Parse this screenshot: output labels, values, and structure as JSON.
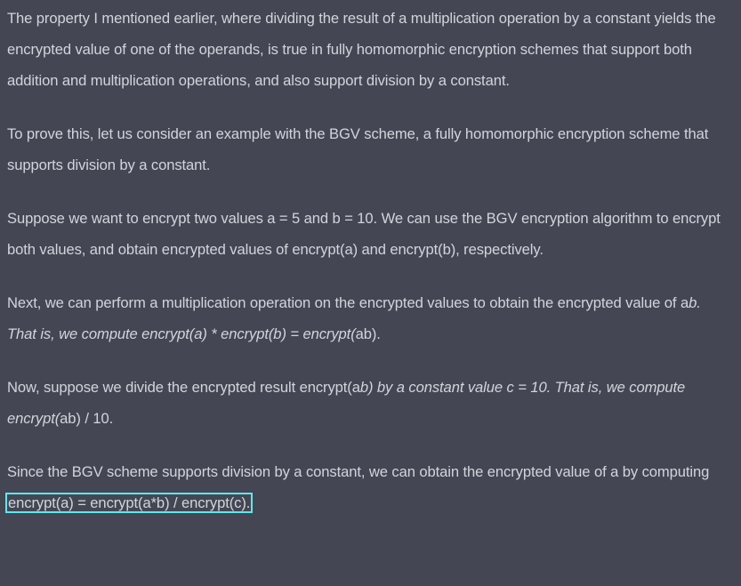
{
  "message": {
    "paragraphs": [
      {
        "segments": [
          {
            "text": "The property I mentioned earlier, where dividing the result of a multiplication operation by a constant yields the encrypted value of one of the operands, is true in fully homomorphic encryption schemes that support both addition and multiplication operations, and also support division by a constant.",
            "style": "normal"
          }
        ]
      },
      {
        "segments": [
          {
            "text": "To prove this, let us consider an example with the BGV scheme, a fully homomorphic encryption scheme that supports division by a constant.",
            "style": "normal"
          }
        ]
      },
      {
        "segments": [
          {
            "text": "Suppose we want to encrypt two values a = 5 and b = 10. We can use the BGV encryption algorithm to encrypt both values, and obtain encrypted values of encrypt(a) and encrypt(b), respectively.",
            "style": "normal"
          }
        ]
      },
      {
        "segments": [
          {
            "text": "Next, we can perform a multiplication operation on the encrypted values to obtain the encrypted value of a",
            "style": "normal"
          },
          {
            "text": "b. That is, we compute encrypt(a) * encrypt(b) = encrypt(",
            "style": "italic"
          },
          {
            "text": "ab).",
            "style": "normal"
          }
        ]
      },
      {
        "segments": [
          {
            "text": "Now, suppose we divide the encrypted result encrypt(a",
            "style": "normal"
          },
          {
            "text": "b) by a constant value c = 10. That is, we compute encrypt(",
            "style": "italic"
          },
          {
            "text": "ab) / 10.",
            "style": "normal"
          }
        ]
      },
      {
        "segments": [
          {
            "text": "Since the BGV scheme supports division by a constant, we can obtain the encrypted value of a by computing ",
            "style": "normal"
          },
          {
            "text": "encrypt(a) = encrypt(a*b) / encrypt(c).",
            "style": "highlight"
          }
        ]
      }
    ],
    "colors": {
      "background": "#444654",
      "text": "#d1d5db",
      "highlight_border": "#5ee9ec"
    }
  }
}
